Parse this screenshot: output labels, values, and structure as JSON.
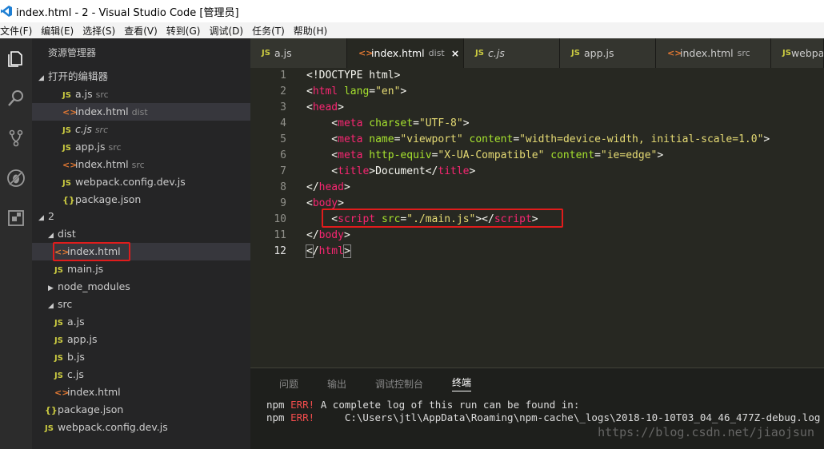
{
  "window": {
    "title": "index.html - 2 - Visual Studio Code [管理员]"
  },
  "menu": [
    "文件(F)",
    "编辑(E)",
    "选择(S)",
    "查看(V)",
    "转到(G)",
    "调试(D)",
    "任务(T)",
    "帮助(H)"
  ],
  "sidebar": {
    "header": "资源管理器",
    "open_editors_label": "打开的编辑器",
    "open_editors": [
      {
        "type": "js",
        "name": "a.js",
        "desc": "src"
      },
      {
        "type": "html",
        "name": "index.html",
        "desc": "dist"
      },
      {
        "type": "js",
        "name": "c.js",
        "desc": "src"
      },
      {
        "type": "js",
        "name": "app.js",
        "desc": "src"
      },
      {
        "type": "html",
        "name": "index.html",
        "desc": "src"
      },
      {
        "type": "js",
        "name": "webpack.config.dev.js",
        "desc": ""
      },
      {
        "type": "json",
        "name": "package.json",
        "desc": ""
      }
    ],
    "workspace_label": "2",
    "tree": [
      {
        "name": "dist",
        "kind": "folder-open"
      },
      {
        "name": "index.html",
        "kind": "html"
      },
      {
        "name": "main.js",
        "kind": "js"
      },
      {
        "name": "node_modules",
        "kind": "folder-closed"
      },
      {
        "name": "src",
        "kind": "folder-open"
      },
      {
        "name": "a.js",
        "kind": "js"
      },
      {
        "name": "app.js",
        "kind": "js"
      },
      {
        "name": "b.js",
        "kind": "js"
      },
      {
        "name": "c.js",
        "kind": "js"
      },
      {
        "name": "index.html",
        "kind": "html"
      },
      {
        "name": "package.json",
        "kind": "json"
      },
      {
        "name": "webpack.config.dev.js",
        "kind": "js"
      }
    ]
  },
  "tabs": [
    {
      "type": "js",
      "name": "a.js",
      "desc": ""
    },
    {
      "type": "html",
      "name": "index.html",
      "desc": "dist",
      "active": true
    },
    {
      "type": "js",
      "name": "c.js",
      "desc": ""
    },
    {
      "type": "js",
      "name": "app.js",
      "desc": ""
    },
    {
      "type": "html",
      "name": "index.html",
      "desc": "src"
    },
    {
      "type": "js",
      "name": "webpa",
      "desc": ""
    }
  ],
  "tab_close_glyph": "×",
  "editor": {
    "line_numbers": [
      "1",
      "2",
      "3",
      "4",
      "5",
      "6",
      "7",
      "8",
      "9",
      "10",
      "11",
      "12"
    ],
    "current_line": "12"
  },
  "panel": {
    "tabs": [
      "问题",
      "输出",
      "调试控制台",
      "终端"
    ],
    "active_tab": "终端",
    "lines": [
      {
        "prefix": "npm ",
        "err": "ERR!",
        "text": " A complete log of this run can be found in:"
      },
      {
        "prefix": "npm ",
        "err": "ERR!",
        "text": "     C:\\Users\\jtl\\AppData\\Roaming\\npm-cache\\_logs\\2018-10-10T03_04_46_477Z-debug.log"
      }
    ]
  },
  "watermark": "https://blog.csdn.net/jiaojsun",
  "colors": {
    "highlight_box": "#e01c1c",
    "tag": "#f92672",
    "attr": "#a6e22e",
    "string": "#e6db74"
  }
}
